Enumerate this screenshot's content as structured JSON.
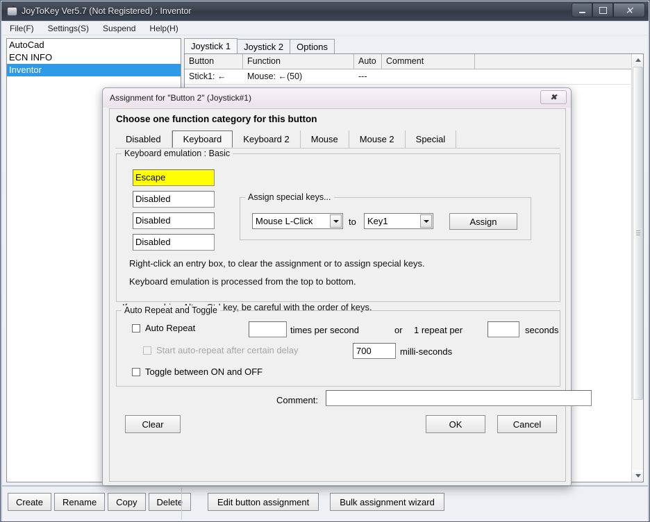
{
  "app": {
    "title": "JoyToKey Ver5.7 (Not Registered) : Inventor",
    "title_icon": "joystick-icon",
    "window_buttons": [
      {
        "name": "minimize",
        "glyph": "minimize-icon"
      },
      {
        "name": "maximize",
        "glyph": "maximize-icon"
      },
      {
        "name": "close",
        "glyph": "close-icon"
      }
    ],
    "menu": [
      {
        "label": "File(F)"
      },
      {
        "label": "Settings(S)"
      },
      {
        "label": "Suspend"
      },
      {
        "label": "Help(H)"
      }
    ],
    "profiles": [
      {
        "label": "AutoCad",
        "selected": false
      },
      {
        "label": "ECN INFO",
        "selected": false
      },
      {
        "label": "Inventor",
        "selected": true
      }
    ],
    "tabs": [
      {
        "label": "Joystick 1",
        "active": true
      },
      {
        "label": "Joystick 2",
        "active": false
      },
      {
        "label": "Options",
        "active": false
      }
    ],
    "grid": {
      "columns": [
        "Button",
        "Function",
        "Auto",
        "Comment",
        ""
      ],
      "rows": [
        {
          "button": "Stick1: ←",
          "function": "Mouse: ←(50)",
          "auto": "---",
          "comment": "",
          "extra": ""
        }
      ]
    },
    "bottom_toolbar": {
      "left_buttons": [
        "Create",
        "Rename",
        "Copy",
        "Delete"
      ],
      "right_buttons": [
        "Edit button assignment",
        "Bulk assignment wizard"
      ]
    }
  },
  "dialog": {
    "title": "Assignment for \"Button 2\" (Joystick#1)",
    "close_glyph": "close-icon",
    "heading": "Choose one function category for this button",
    "category_tabs": [
      {
        "label": "Disabled",
        "active": false
      },
      {
        "label": "Keyboard",
        "active": true
      },
      {
        "label": "Keyboard 2",
        "active": false
      },
      {
        "label": "Mouse",
        "active": false
      },
      {
        "label": "Mouse 2",
        "active": false
      },
      {
        "label": "Special",
        "active": false
      }
    ],
    "keyboard_group": {
      "legend": "Keyboard emulation : Basic",
      "entries": [
        {
          "value": "Escape",
          "highlighted": true
        },
        {
          "value": "Disabled",
          "highlighted": false
        },
        {
          "value": "Disabled",
          "highlighted": false
        },
        {
          "value": "Disabled",
          "highlighted": false
        }
      ],
      "special_keys": {
        "legend": "Assign special keys...",
        "source_value": "Mouse L-Click",
        "to_label": "to",
        "target_value": "Key1",
        "assign_button": "Assign"
      },
      "hints": [
        "Right-click an entry box, to clear the assignment or to assign special keys.",
        "Keyboard emulation is processed from the top to bottom.",
        "If you combine Alt or Ctrl key, be careful with the order of keys."
      ]
    },
    "auto_repeat_group": {
      "legend": "Auto Repeat and Toggle",
      "auto_repeat_label": "Auto Repeat",
      "auto_repeat_checked": false,
      "rate_value": "",
      "times_per_second_label": "times per second",
      "or_label": "or",
      "one_repeat_per_label": "1 repeat per",
      "seconds_value": "",
      "seconds_label": "seconds",
      "delay_label": "Start auto-repeat after certain delay",
      "delay_checked": false,
      "delay_value": "700",
      "milliseconds_label": "milli-seconds",
      "toggle_label": "Toggle between ON and OFF",
      "toggle_checked": false
    },
    "comment_label": "Comment:",
    "comment_value": "",
    "comment_placeholder": "",
    "footer_buttons": {
      "clear": "Clear",
      "ok": "OK",
      "cancel": "Cancel"
    }
  },
  "colors": {
    "selection_blue": "#2e9ae8",
    "highlight_yellow": "#ffff00",
    "dialog_bg": "#f0f0f0",
    "titlebar_dark": "#3b424e"
  }
}
